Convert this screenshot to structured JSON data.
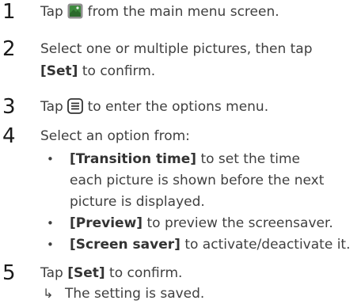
{
  "steps": [
    {
      "number": "1",
      "before_icon": "Tap",
      "icon": "screensaver-app-icon",
      "after_icon": "from the main menu screen."
    },
    {
      "number": "2",
      "line1": "Select one or multiple pictures, then tap",
      "bold": "[Set]",
      "line2_rest": "to confirm."
    },
    {
      "number": "3",
      "before_icon": "Tap",
      "icon": "options-menu-icon",
      "after_icon": "to enter the options menu."
    },
    {
      "number": "4",
      "text": "Select an option from:",
      "bullets": [
        {
          "bold": "[Transition time]",
          "line1_rest": "to set the time",
          "line2": "each picture is shown before the next",
          "line3": "picture is displayed."
        },
        {
          "bold": "[Preview]",
          "rest": "to preview the screensaver."
        },
        {
          "bold": "[Screen saver]",
          "rest": "to activate/deactivate it."
        }
      ]
    },
    {
      "number": "5",
      "before": "Tap",
      "bold": "[Set]",
      "after": "to confirm.",
      "result_arrow": "↳",
      "result": "The setting is saved."
    }
  ],
  "bullet_char": "•",
  "colors": {
    "text": "#3f3f3f",
    "icon_green": "#3d8a3d",
    "icon_gray": "#8f8f8f"
  }
}
